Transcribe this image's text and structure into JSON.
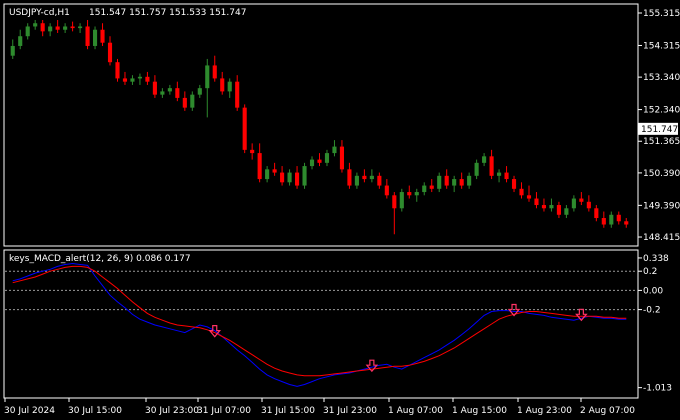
{
  "window": {
    "title": "USDJPY-cd,H1",
    "ohlc": "151.547 151.757 151.533 151.747"
  },
  "indicator": {
    "label": "keys_MACD_alert(12, 26, 9) 0.086 0.177"
  },
  "colors": {
    "background": "#000000",
    "frame": "#ffffff",
    "bull": "#2e8b2e",
    "bear": "#ff0000",
    "macd_line": "#0000ff",
    "signal_line": "#ff0000",
    "price_tag_bg": "#ffffff",
    "price_tag_fg": "#000000",
    "arrow": "#ff3366"
  },
  "icons": {
    "alert_marker": "down-arrow-icon"
  },
  "chart_data": [
    {
      "type": "candlestick",
      "symbol": "USDJPY-cd",
      "timeframe": "H1",
      "ylim": [
        148.2,
        155.5
      ],
      "yticks": [
        "155.315",
        "154.315",
        "153.340",
        "152.340",
        "151.365",
        "150.390",
        "149.390",
        "148.415"
      ],
      "current_price": "151.747",
      "candles": [
        [
          154.0,
          154.5,
          153.9,
          154.3
        ],
        [
          154.3,
          154.8,
          154.2,
          154.6
        ],
        [
          154.6,
          155.0,
          154.5,
          154.9
        ],
        [
          154.9,
          155.1,
          154.8,
          155.0
        ],
        [
          155.0,
          155.1,
          154.6,
          154.75
        ],
        [
          154.75,
          155.0,
          154.6,
          154.9
        ],
        [
          154.9,
          155.1,
          154.7,
          154.8
        ],
        [
          154.8,
          155.0,
          154.7,
          154.9
        ],
        [
          154.9,
          155.05,
          154.75,
          154.85
        ],
        [
          154.85,
          155.0,
          154.7,
          154.9
        ],
        [
          154.9,
          155.1,
          154.2,
          154.3
        ],
        [
          154.3,
          154.9,
          154.2,
          154.8
        ],
        [
          154.8,
          155.0,
          154.3,
          154.4
        ],
        [
          154.4,
          154.6,
          153.7,
          153.8
        ],
        [
          153.8,
          153.9,
          153.2,
          153.3
        ],
        [
          153.3,
          153.5,
          153.1,
          153.2
        ],
        [
          153.2,
          153.4,
          153.1,
          153.3
        ],
        [
          153.3,
          153.45,
          153.1,
          153.35
        ],
        [
          153.35,
          153.5,
          153.1,
          153.2
        ],
        [
          153.2,
          153.4,
          152.7,
          152.8
        ],
        [
          152.8,
          153.0,
          152.7,
          152.9
        ],
        [
          152.9,
          153.1,
          152.8,
          153.0
        ],
        [
          153.0,
          153.2,
          152.6,
          152.7
        ],
        [
          152.7,
          152.9,
          152.3,
          152.4
        ],
        [
          152.4,
          152.9,
          152.3,
          152.8
        ],
        [
          152.8,
          153.1,
          152.7,
          153.0
        ],
        [
          153.0,
          153.9,
          152.1,
          153.7
        ],
        [
          153.7,
          154.0,
          153.2,
          153.3
        ],
        [
          153.3,
          153.5,
          152.8,
          152.9
        ],
        [
          152.9,
          153.3,
          152.7,
          153.2
        ],
        [
          153.2,
          153.4,
          152.3,
          152.4
        ],
        [
          152.4,
          152.5,
          151.0,
          151.1
        ],
        [
          151.1,
          151.3,
          150.8,
          151.0
        ],
        [
          151.0,
          151.3,
          150.1,
          150.2
        ],
        [
          150.2,
          150.6,
          150.1,
          150.5
        ],
        [
          150.5,
          150.7,
          150.3,
          150.4
        ],
        [
          150.4,
          150.6,
          150.0,
          150.1
        ],
        [
          150.1,
          150.5,
          150.0,
          150.4
        ],
        [
          150.4,
          150.6,
          149.9,
          150.0
        ],
        [
          150.0,
          150.7,
          149.9,
          150.6
        ],
        [
          150.6,
          150.9,
          150.5,
          150.8
        ],
        [
          150.8,
          151.0,
          150.6,
          150.7
        ],
        [
          150.7,
          151.1,
          150.6,
          151.0
        ],
        [
          151.0,
          151.4,
          150.9,
          151.2
        ],
        [
          151.2,
          151.4,
          150.4,
          150.5
        ],
        [
          150.5,
          150.7,
          149.9,
          150.0
        ],
        [
          150.0,
          150.4,
          149.9,
          150.3
        ],
        [
          150.3,
          150.5,
          150.1,
          150.2
        ],
        [
          150.2,
          150.5,
          150.1,
          150.3
        ],
        [
          150.3,
          150.4,
          149.9,
          150.0
        ],
        [
          150.0,
          150.2,
          149.6,
          149.7
        ],
        [
          149.7,
          149.8,
          148.5,
          149.3
        ],
        [
          149.3,
          149.9,
          149.2,
          149.8
        ],
        [
          149.8,
          150.0,
          149.6,
          149.7
        ],
        [
          149.7,
          149.9,
          149.5,
          149.8
        ],
        [
          149.8,
          150.1,
          149.7,
          150.0
        ],
        [
          150.0,
          150.2,
          149.8,
          149.9
        ],
        [
          149.9,
          150.4,
          149.8,
          150.3
        ],
        [
          150.3,
          150.5,
          149.9,
          150.0
        ],
        [
          150.0,
          150.3,
          149.8,
          150.2
        ],
        [
          150.2,
          150.4,
          149.9,
          150.0
        ],
        [
          150.0,
          150.4,
          149.9,
          150.3
        ],
        [
          150.3,
          150.8,
          150.2,
          150.7
        ],
        [
          150.7,
          151.0,
          150.6,
          150.9
        ],
        [
          150.9,
          151.1,
          150.2,
          150.3
        ],
        [
          150.3,
          150.5,
          150.1,
          150.4
        ],
        [
          150.4,
          150.6,
          150.1,
          150.2
        ],
        [
          150.2,
          150.3,
          149.8,
          149.9
        ],
        [
          149.9,
          150.1,
          149.6,
          149.7
        ],
        [
          149.7,
          150.0,
          149.5,
          149.6
        ],
        [
          149.6,
          149.8,
          149.3,
          149.4
        ],
        [
          149.4,
          149.6,
          149.2,
          149.3
        ],
        [
          149.3,
          149.6,
          149.2,
          149.4
        ],
        [
          149.4,
          149.5,
          149.0,
          149.1
        ],
        [
          149.1,
          149.4,
          149.0,
          149.3
        ],
        [
          149.3,
          149.7,
          149.2,
          149.6
        ],
        [
          149.6,
          149.8,
          149.4,
          149.5
        ],
        [
          149.5,
          149.7,
          149.2,
          149.3
        ],
        [
          149.3,
          149.4,
          148.9,
          149.0
        ],
        [
          149.0,
          149.2,
          148.7,
          148.8
        ],
        [
          148.8,
          149.2,
          148.7,
          149.1
        ],
        [
          149.1,
          149.2,
          148.8,
          148.9
        ],
        [
          148.9,
          149.0,
          148.7,
          148.8
        ]
      ]
    },
    {
      "type": "line",
      "name": "keys_MACD_alert(12, 26, 9)",
      "ylim": [
        -1.1,
        0.4
      ],
      "yticks": [
        "0.338",
        "0.2",
        "0.00",
        "-0.2",
        "-1.013"
      ],
      "hlines": [
        0.2,
        0.0,
        -0.2
      ],
      "x": [
        "30 Jul 2024",
        "30 Jul 15:00",
        "30 Jul 23:00",
        "31 Jul 07:00",
        "31 Jul 15:00",
        "31 Jul 23:00",
        "1 Aug 07:00",
        "1 Aug 15:00",
        "1 Aug 23:00",
        "2 Aug 07:00"
      ],
      "series": [
        {
          "values": [
            0.1,
            0.12,
            0.15,
            0.18,
            0.2,
            0.22,
            0.25,
            0.27,
            0.28,
            0.27,
            0.26,
            0.15,
            0.05,
            -0.05,
            -0.12,
            -0.18,
            -0.25,
            -0.3,
            -0.33,
            -0.36,
            -0.38,
            -0.4,
            -0.42,
            -0.44,
            -0.4,
            -0.36,
            -0.38,
            -0.42,
            -0.48,
            -0.55,
            -0.62,
            -0.68,
            -0.75,
            -0.82,
            -0.88,
            -0.92,
            -0.95,
            -0.98,
            -1.0,
            -0.98,
            -0.95,
            -0.92,
            -0.9,
            -0.88,
            -0.87,
            -0.86,
            -0.84,
            -0.82,
            -0.8,
            -0.78,
            -0.77,
            -0.8,
            -0.82,
            -0.78,
            -0.74,
            -0.7,
            -0.66,
            -0.62,
            -0.57,
            -0.52,
            -0.46,
            -0.4,
            -0.33,
            -0.26,
            -0.22,
            -0.21,
            -0.21,
            -0.22,
            -0.22,
            -0.24,
            -0.25,
            -0.26,
            -0.28,
            -0.29,
            -0.3,
            -0.31,
            -0.29,
            -0.27,
            -0.28,
            -0.29,
            -0.29,
            -0.3,
            -0.3
          ]
        },
        {
          "values": [
            0.08,
            0.1,
            0.12,
            0.14,
            0.17,
            0.2,
            0.22,
            0.24,
            0.25,
            0.25,
            0.24,
            0.2,
            0.14,
            0.08,
            0.02,
            -0.05,
            -0.12,
            -0.18,
            -0.24,
            -0.28,
            -0.31,
            -0.34,
            -0.36,
            -0.37,
            -0.38,
            -0.39,
            -0.41,
            -0.44,
            -0.48,
            -0.52,
            -0.57,
            -0.62,
            -0.67,
            -0.72,
            -0.77,
            -0.81,
            -0.84,
            -0.86,
            -0.88,
            -0.89,
            -0.89,
            -0.89,
            -0.88,
            -0.87,
            -0.86,
            -0.85,
            -0.84,
            -0.83,
            -0.82,
            -0.81,
            -0.8,
            -0.79,
            -0.79,
            -0.78,
            -0.76,
            -0.74,
            -0.71,
            -0.68,
            -0.64,
            -0.6,
            -0.55,
            -0.5,
            -0.45,
            -0.4,
            -0.35,
            -0.3,
            -0.27,
            -0.25,
            -0.23,
            -0.22,
            -0.22,
            -0.23,
            -0.24,
            -0.25,
            -0.26,
            -0.27,
            -0.27,
            -0.27,
            -0.27,
            -0.28,
            -0.28,
            -0.29,
            -0.29
          ]
        }
      ],
      "alerts": [
        {
          "index": 27,
          "value": -0.44
        },
        {
          "index": 48,
          "value": -0.8
        },
        {
          "index": 67,
          "value": -0.22
        },
        {
          "index": 76,
          "value": -0.27
        }
      ]
    }
  ]
}
